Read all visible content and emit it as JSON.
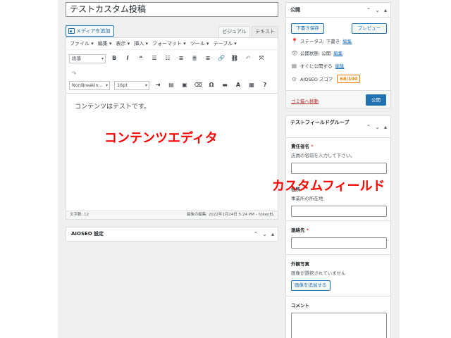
{
  "title_value": "テストカスタム投稿",
  "media_button": "メディアを追加",
  "editor_tabs": {
    "visual": "ビジュアル",
    "text": "テキスト"
  },
  "menubar": [
    "ファイル ▾",
    "編集 ▾",
    "表示 ▾",
    "挿入 ▾",
    "フォーマット ▾",
    "ツール ▾",
    "テーブル ▾"
  ],
  "toolbar1": {
    "format_select": "段落",
    "icons": [
      "B",
      "I",
      "❝",
      "☰",
      "☷",
      "≡",
      "≣",
      "≡",
      "🔗",
      "⛓",
      "↶",
      "⤧"
    ]
  },
  "toolbar2": {
    "font_select": "NonBreakin...",
    "size_select": "16pt"
  },
  "content_text": "コンテンツはテストです。",
  "word_count": "文字数: 12",
  "last_edited": "最後の編集: 2022年1月24日 5:24 PM – tokenEL",
  "aioseo_box_title": "AIOSEO 設定",
  "overlay": {
    "editor_label": "コンテンツエディタ",
    "custom_field_label": "カスタムフィールド"
  },
  "publish_box": {
    "title": "公開",
    "save_draft": "下書き保存",
    "preview": "プレビュー",
    "status_label": "ステータス: 下書き",
    "visibility_label": "公開状態: 公開",
    "schedule_label": "すぐに公開する",
    "edit_link": "編集",
    "aioseo_score_label": "AIOSEO スコア",
    "aioseo_score": "68/100",
    "trash": "ゴミ箱へ移動",
    "publish": "公開"
  },
  "custom_field_box": {
    "title": "テストフィールドグループ",
    "field1_label": "責任者名",
    "field1_desc": "店員の名前を入力して下さい。",
    "field2_label": "住所",
    "field2_desc": "事業所の所在地",
    "field3_label": "連絡先",
    "field4_label": "外観写真",
    "field4_desc": "画像が選択されていません",
    "add_image": "画像を追加する",
    "field5_label": "コメント",
    "required_mark": "*"
  }
}
